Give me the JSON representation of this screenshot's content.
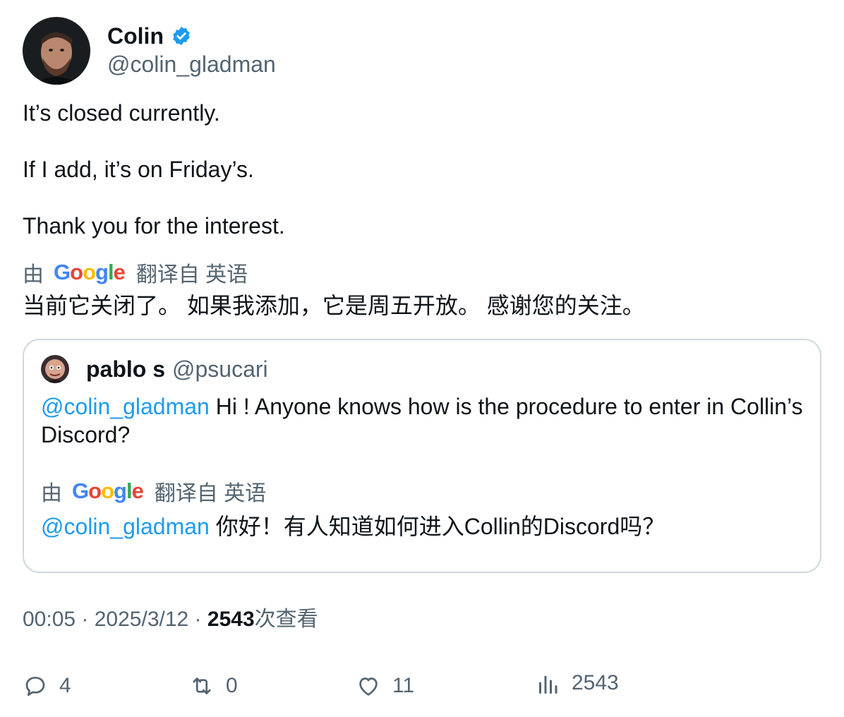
{
  "author": {
    "name": "Colin",
    "handle": "@colin_gladman",
    "verified": true
  },
  "body": {
    "line1": "It’s closed currently.",
    "line2": "If I add, it’s on Friday’s.",
    "line3": "Thank you for the interest."
  },
  "translation": {
    "prefix": "由",
    "provider": "Google",
    "suffix": "翻译自 英语",
    "text": "当前它关闭了。 如果我添加，它是周五开放。 感谢您的关注。"
  },
  "quote": {
    "name": "pablo s",
    "handle": "@psucari",
    "mention": "@colin_gladman",
    "text": " Hi ! Anyone knows how is the procedure to enter in Collin’s Discord?",
    "translation_prefix": "由",
    "translation_provider": "Google",
    "translation_suffix": "翻译自 英语",
    "translated_mention": "@colin_gladman",
    "translated_text": " 你好！有人知道如何进入Collin的Discord吗？"
  },
  "meta": {
    "time": "00:05",
    "sep1": " · ",
    "date": "2025/3/12",
    "sep2": " · ",
    "views": "2543",
    "views_label": "次查看"
  },
  "actions": {
    "replies": "4",
    "retweets": "0",
    "likes": "11",
    "views": "2543"
  },
  "colors": {
    "accent": "#1d9bf0",
    "secondary_text": "#536471",
    "border": "#cfd9de"
  }
}
